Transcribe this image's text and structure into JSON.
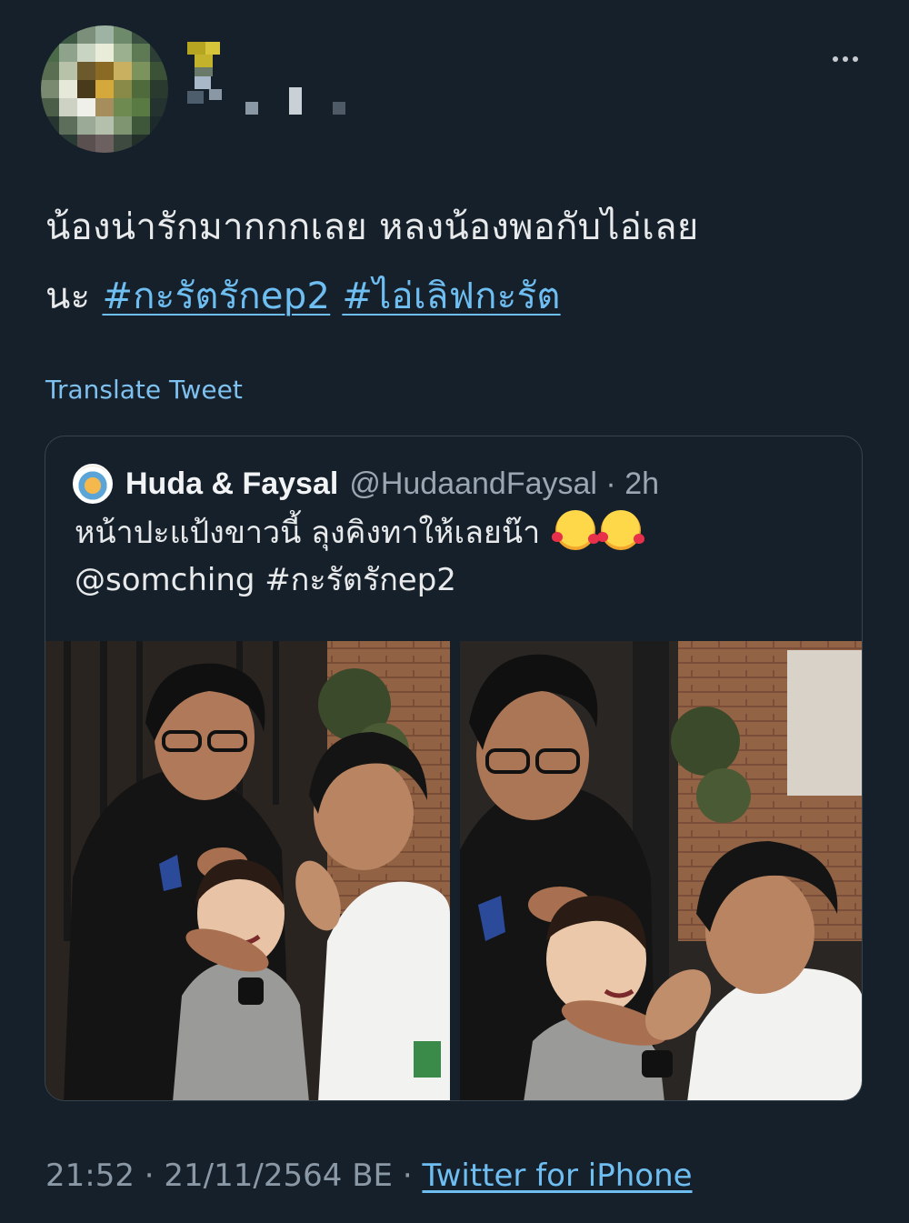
{
  "tweet": {
    "text_line1": "น้องน่ารักมากกกเลย หลงน้องพอกับไอ่เลย",
    "text_line2_prefix": "นะ ",
    "hashtags": [
      "#กะรัตรักep2",
      "#ไอ่เลิฟกะรัต"
    ],
    "translate_label": "Translate Tweet",
    "time": "21:52",
    "date": "21/11/2564 BE",
    "separator": " · ",
    "source": "Twitter for iPhone"
  },
  "quote": {
    "name": "Huda & Faysal",
    "handle": "@HudaandFaysal · 2h",
    "text_line1": "หน้าปะแป้งขาวนี้ ลุงคิงทาให้เลยน๊า",
    "text_line2": "@somching #กะรัตรักep2",
    "emoji": [
      "smiling-face-with-hearts",
      "smiling-face-with-hearts"
    ]
  },
  "colors": {
    "background": "#15202b",
    "text": "#e7e9ea",
    "link": "#6fbef2",
    "muted": "#8b98a5",
    "border": "#38444d"
  }
}
